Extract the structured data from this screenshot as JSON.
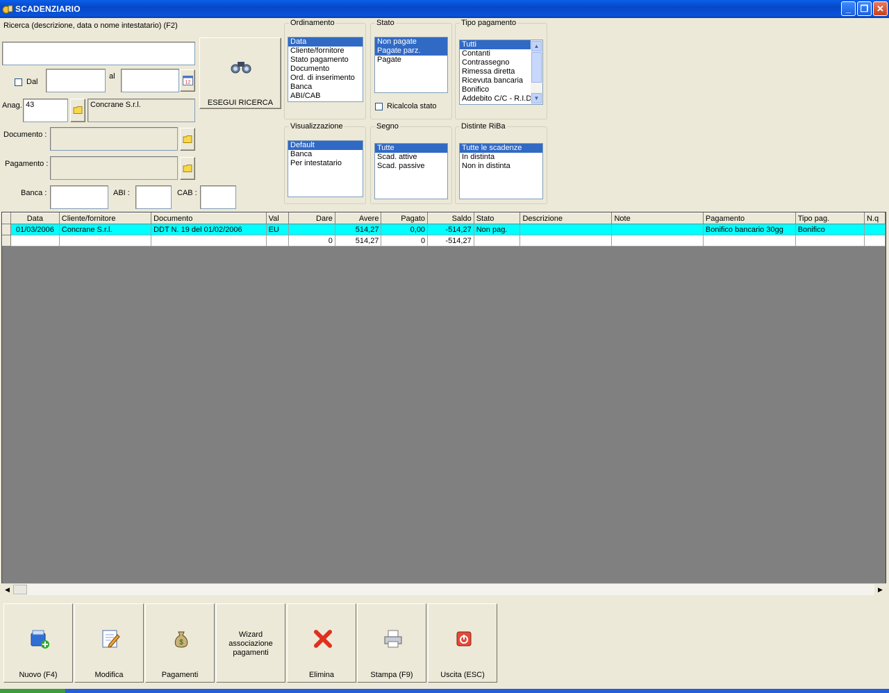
{
  "window": {
    "title": "SCADENZIARIO",
    "min": "_",
    "restore": "❐",
    "close": "✕"
  },
  "search": {
    "label": "Ricerca (descrizione, data o nome intestatario) (F2)",
    "value": "",
    "dal_label": "Dal",
    "al_label": "al",
    "dal_value": "",
    "al_value": "",
    "anag_label": "Anag.",
    "anag_code": "43",
    "anag_name": "Concrane S.r.l.",
    "documento_label": "Documento :",
    "documento_value": "",
    "pagamento_label": "Pagamento :",
    "pagamento_value": "",
    "banca_label": "Banca :",
    "banca_value": "",
    "abi_label": "ABI :",
    "abi_value": "",
    "cab_label": "CAB :",
    "cab_value": "",
    "run_button": "ESEGUI RICERCA"
  },
  "groups": {
    "ordinamento": {
      "title": "Ordinamento",
      "items": [
        "Data",
        "Cliente/fornitore",
        "Stato pagamento",
        "Documento",
        "Ord. di inserimento",
        "Banca",
        "ABI/CAB"
      ]
    },
    "stato": {
      "title": "Stato",
      "items": [
        "Non pagate",
        "Pagate parz.",
        "Pagate"
      ],
      "ricalcola": "Ricalcola stato"
    },
    "tipo_pagamento": {
      "title": "Tipo pagamento",
      "items": [
        "Tutti",
        "Contanti",
        "Contrassegno",
        "Rimessa diretta",
        "Ricevuta bancaria",
        "Bonifico",
        "Addebito C/C - R.I.D"
      ]
    },
    "visualizzazione": {
      "title": "Visualizzazione",
      "items": [
        "Default",
        "Banca",
        "Per intestatario"
      ]
    },
    "segno": {
      "title": "Segno",
      "items": [
        "Tutte",
        "Scad. attive",
        "Scad. passive"
      ]
    },
    "distinte": {
      "title": "Distinte RiBa",
      "items": [
        "Tutte le scadenze",
        "In distinta",
        "Non in distinta"
      ]
    }
  },
  "grid": {
    "columns": [
      "Data",
      "Cliente/fornitore",
      "Documento",
      "Val",
      "Dare",
      "Avere",
      "Pagato",
      "Saldo",
      "Stato",
      "Descrizione",
      "Note",
      "Pagamento",
      "Tipo pag.",
      "N.q"
    ],
    "rows": [
      [
        "01/03/2006",
        "Concrane S.r.l.",
        "DDT N. 19 del 01/02/2006",
        "EU",
        "",
        "514,27",
        "0,00",
        "-514,27",
        "Non pag.",
        "",
        "",
        "Bonifico bancario 30gg",
        "Bonifico",
        ""
      ]
    ],
    "totals": [
      "",
      "",
      "",
      "",
      "0",
      "514,27",
      "0",
      "-514,27",
      "",
      "",
      "",
      "",
      "",
      ""
    ]
  },
  "toolbar": {
    "nuovo": "Nuovo (F4)",
    "modifica": "Modifica",
    "pagamenti": "Pagamenti",
    "wizard": "Wizard\nassociazione\npagamenti",
    "elimina": "Elimina",
    "stampa": "Stampa (F9)",
    "uscita": "Uscita (ESC)"
  }
}
